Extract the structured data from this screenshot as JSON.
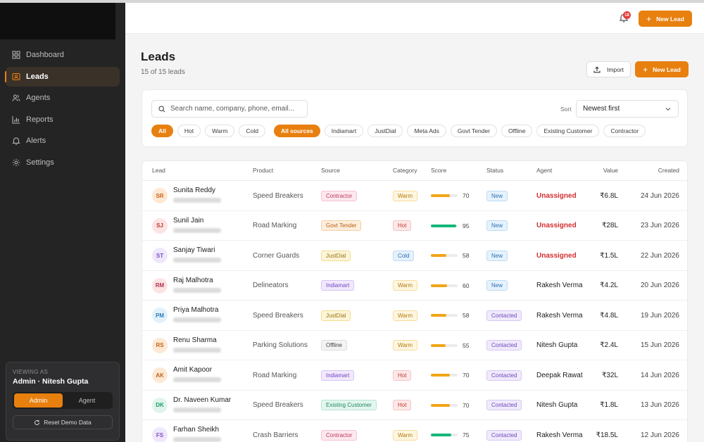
{
  "sidebar": {
    "nav": [
      {
        "label": "Dashboard",
        "icon": "grid-icon",
        "active": false
      },
      {
        "label": "Leads",
        "icon": "contact-card-icon",
        "active": true
      },
      {
        "label": "Agents",
        "icon": "users-icon",
        "active": false
      },
      {
        "label": "Reports",
        "icon": "bar-chart-icon",
        "active": false
      },
      {
        "label": "Alerts",
        "icon": "bell-icon",
        "active": false
      },
      {
        "label": "Settings",
        "icon": "gear-icon",
        "active": false
      }
    ],
    "viewing": {
      "label": "VIEWING AS",
      "name": "Admin · Nitesh Gupta",
      "roles": [
        "Admin",
        "Agent"
      ],
      "active_role": "Admin",
      "reset_label": "Reset Demo Data"
    }
  },
  "topbar": {
    "notification_count": "18",
    "new_lead_label": "New Lead"
  },
  "header": {
    "title": "Leads",
    "subtitle": "15 of 15 leads",
    "import_label": "Import",
    "new_lead_label": "New Lead"
  },
  "filters": {
    "search_placeholder": "Search name, company, phone, email...",
    "sort_label": "Sort",
    "sort_value": "Newest first",
    "temperature_chips": [
      "All",
      "Hot",
      "Warm",
      "Cold"
    ],
    "temperature_active": "All",
    "source_chips": [
      "All sources",
      "Indiamart",
      "JustDial",
      "Meta Ads",
      "Govt Tender",
      "Offline",
      "Existing Customer",
      "Contractor"
    ],
    "source_active": "All sources"
  },
  "table": {
    "columns": [
      "Lead",
      "Product",
      "Source",
      "Category",
      "Score",
      "Status",
      "Agent",
      "Value",
      "Created"
    ],
    "rows": [
      {
        "initials": "SR",
        "name": "Sunita Reddy",
        "product": "Speed Breakers",
        "source": "Contractor",
        "category": "Warm",
        "score": 70,
        "status": "New",
        "agent": "Unassigned",
        "value": "₹6.8L",
        "created": "24 Jun 2026"
      },
      {
        "initials": "SJ",
        "name": "Sunil Jain",
        "product": "Road Marking",
        "source": "Govt Tender",
        "category": "Hot",
        "score": 95,
        "status": "New",
        "agent": "Unassigned",
        "value": "₹28L",
        "created": "23 Jun 2026"
      },
      {
        "initials": "ST",
        "name": "Sanjay Tiwari",
        "product": "Corner Guards",
        "source": "JustDial",
        "category": "Cold",
        "score": 58,
        "status": "New",
        "agent": "Unassigned",
        "value": "₹1.5L",
        "created": "22 Jun 2026"
      },
      {
        "initials": "RM",
        "name": "Raj Malhotra",
        "product": "Delineators",
        "source": "Indiamart",
        "category": "Warm",
        "score": 60,
        "status": "New",
        "agent": "Rakesh Verma",
        "value": "₹4.2L",
        "created": "20 Jun 2026"
      },
      {
        "initials": "PM",
        "name": "Priya Malhotra",
        "product": "Speed Breakers",
        "source": "JustDial",
        "category": "Warm",
        "score": 58,
        "status": "Contacted",
        "agent": "Rakesh Verma",
        "value": "₹4.8L",
        "created": "19 Jun 2026"
      },
      {
        "initials": "RS",
        "name": "Renu Sharma",
        "product": "Parking Solutions",
        "source": "Offline",
        "category": "Warm",
        "score": 55,
        "status": "Contacted",
        "agent": "Nitesh Gupta",
        "value": "₹2.4L",
        "created": "15 Jun 2026"
      },
      {
        "initials": "AK",
        "name": "Amit Kapoor",
        "product": "Road Marking",
        "source": "Indiamart",
        "category": "Hot",
        "score": 70,
        "status": "Contacted",
        "agent": "Deepak Rawat",
        "value": "₹32L",
        "created": "14 Jun 2026"
      },
      {
        "initials": "DK",
        "name": "Dr. Naveen Kumar",
        "product": "Speed Breakers",
        "source": "Existing Customer",
        "category": "Hot",
        "score": 70,
        "status": "Contacted",
        "agent": "Nitesh Gupta",
        "value": "₹1.8L",
        "created": "13 Jun 2026"
      },
      {
        "initials": "FS",
        "name": "Farhan Sheikh",
        "product": "Crash Barriers",
        "source": "Contractor",
        "category": "Warm",
        "score": 75,
        "status": "Contacted",
        "agent": "Rakesh Verma",
        "value": "₹18.5L",
        "created": "12 Jun 2026"
      }
    ]
  },
  "colors": {
    "accent": "#e8800f",
    "unassigned": "#d32f2f",
    "score_orange": "#f2a516",
    "score_green": "#14b87a"
  }
}
